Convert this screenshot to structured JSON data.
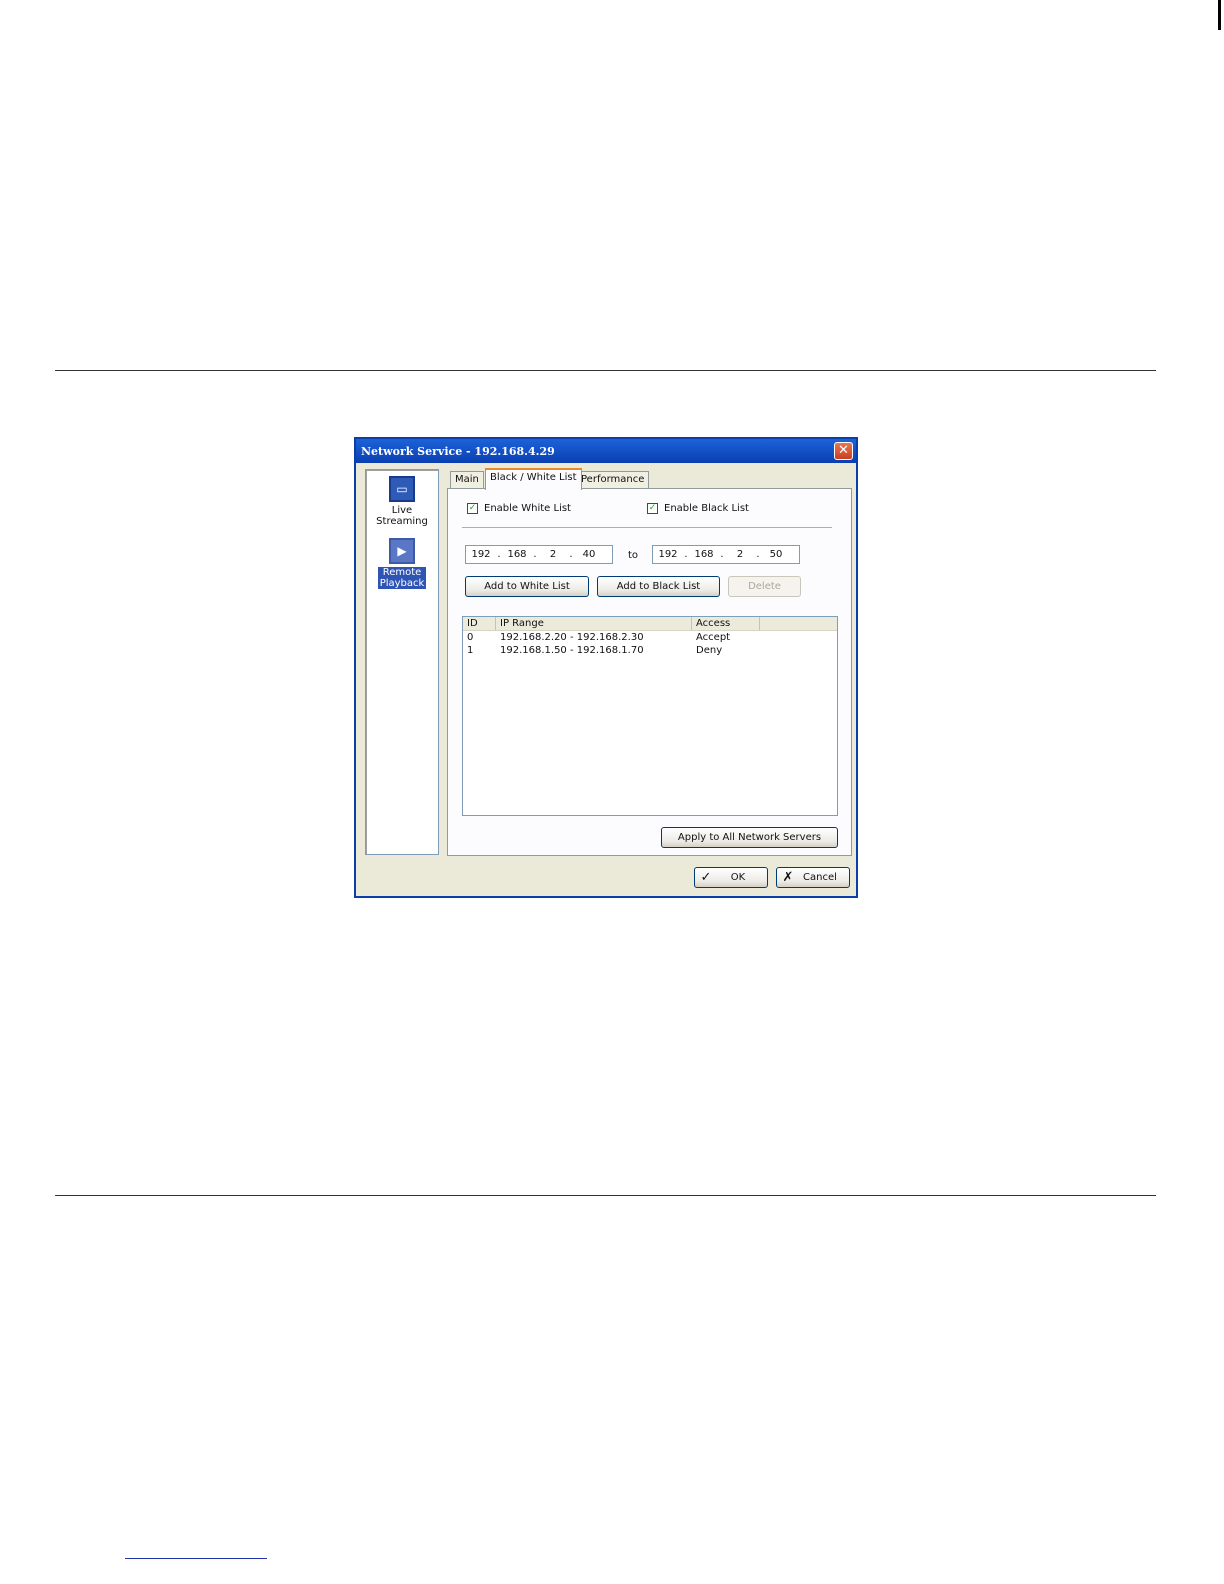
{
  "dialog": {
    "title": "Network Service - 192.168.4.29",
    "close_glyph": "✕"
  },
  "sidebar": {
    "items": [
      {
        "label_line1": "Live",
        "label_line2": "Streaming",
        "icon": "monitor-icon",
        "selected": false
      },
      {
        "label_line1": "Remote",
        "label_line2": "Playback",
        "icon": "play-icon",
        "selected": true
      }
    ]
  },
  "tabs": [
    {
      "label": "Main",
      "active": false
    },
    {
      "label": "Black / White List",
      "active": true
    },
    {
      "label": "Performance",
      "active": false
    }
  ],
  "options": {
    "enable_white_list": {
      "label": "Enable White List",
      "checked": true
    },
    "enable_black_list": {
      "label": "Enable Black List",
      "checked": true
    }
  },
  "ip_range": {
    "from": [
      "192",
      "168",
      "2",
      "40"
    ],
    "to_label": "to",
    "to": [
      "192",
      "168",
      "2",
      "50"
    ]
  },
  "buttons": {
    "add_white": "Add to White List",
    "add_black": "Add to Black List",
    "delete": "Delete",
    "apply_all": "Apply to All Network Servers",
    "ok": "OK",
    "cancel": "Cancel"
  },
  "list": {
    "columns": [
      "ID",
      "IP Range",
      "Access"
    ],
    "rows": [
      {
        "id": "0",
        "range": "192.168.2.20 - 192.168.2.30",
        "access": "Accept"
      },
      {
        "id": "1",
        "range": "192.168.1.50 - 192.168.1.70",
        "access": "Deny"
      }
    ]
  },
  "colors": {
    "titlebar": "#0a3fb0",
    "selection": "#2f55b4",
    "dialog_face": "#ebe9d8"
  }
}
